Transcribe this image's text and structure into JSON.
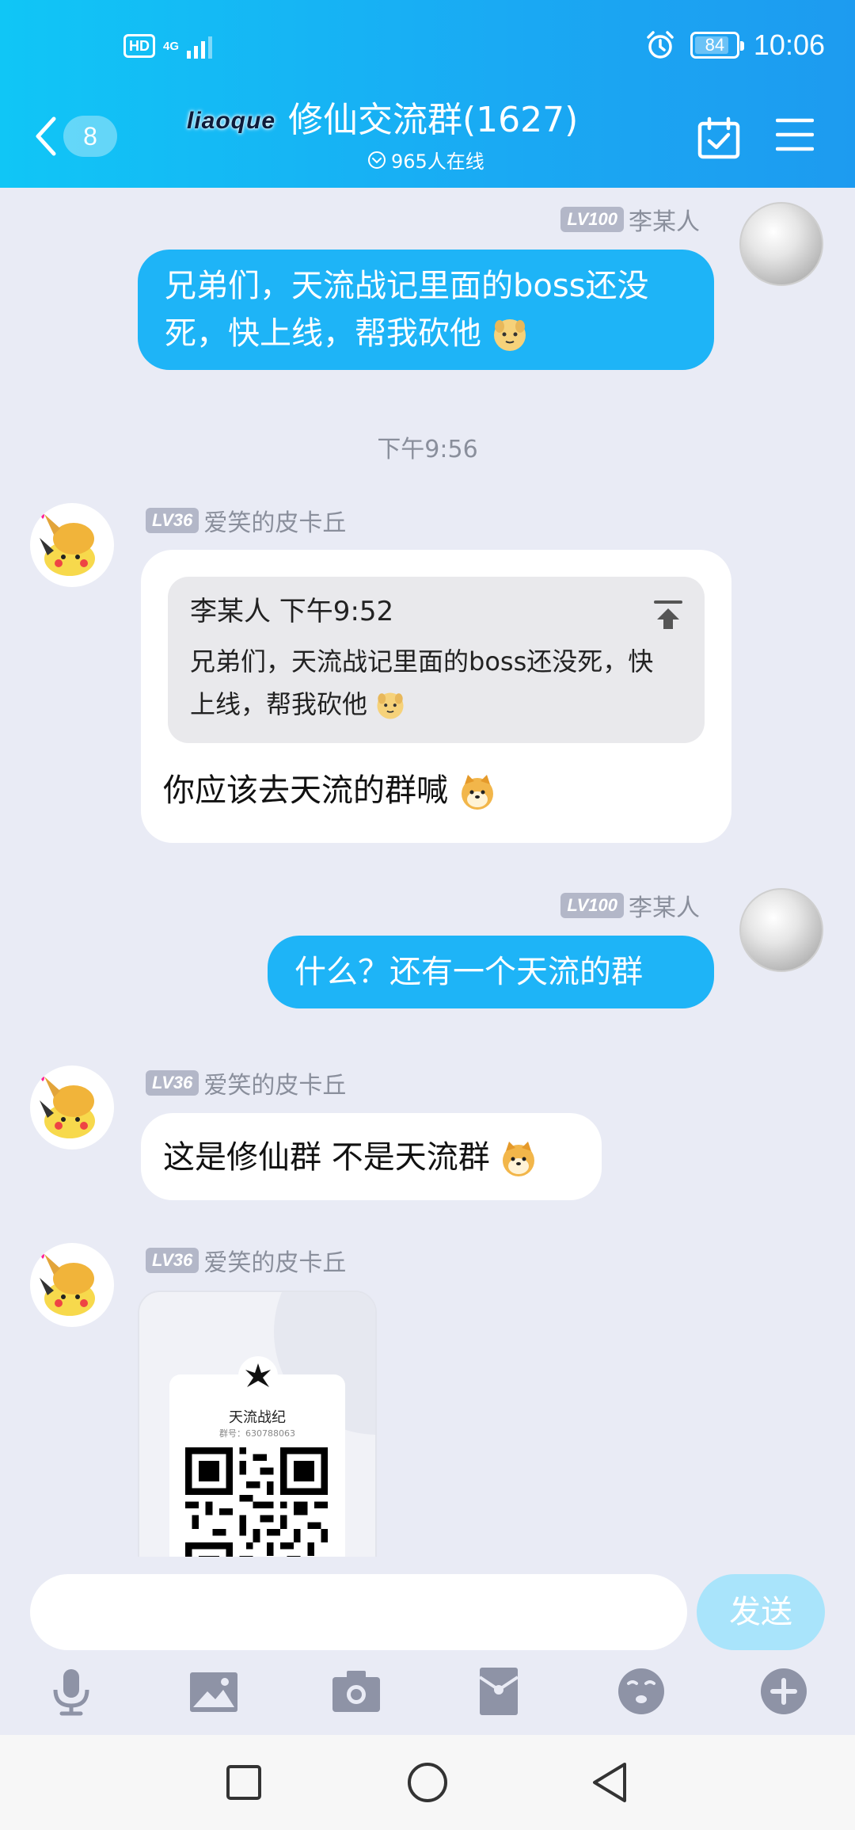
{
  "status_bar": {
    "hd": "HD",
    "network": "4G",
    "battery": "84",
    "battery_level": 0.84,
    "time": "10:06"
  },
  "header": {
    "unread_count": "8",
    "group_logo_text": "liaoque",
    "group_title": "修仙交流群(1627)",
    "online_text": "965人在线"
  },
  "messages": {
    "m1": {
      "lv": "LV100",
      "sender": "李某人",
      "text": "兄弟们，天流战记里面的boss还没死，快上线，帮我砍他"
    },
    "time_sep": "下午9:56",
    "m2": {
      "lv": "LV36",
      "sender": "爱笑的皮卡丘",
      "quote_header": "李某人 下午9:52",
      "quote_text": "兄弟们，天流战记里面的boss还没死，快上线，帮我砍他",
      "text": "你应该去天流的群喊"
    },
    "m3": {
      "lv": "LV100",
      "sender": "李某人",
      "text": "什么？还有一个天流的群"
    },
    "m4": {
      "lv": "LV36",
      "sender": "爱笑的皮卡丘",
      "text": "这是修仙群 不是天流群"
    },
    "m5": {
      "lv": "LV36",
      "sender": "爱笑的皮卡丘",
      "card_title": "天流战纪",
      "card_number": "群号：630788063"
    }
  },
  "input": {
    "value": "",
    "placeholder": "",
    "send_label": "发送"
  },
  "colors": {
    "header_start": "#10c6f6",
    "header_end": "#1d9bf0",
    "bubble_self": "#1eb4f7",
    "chat_bg": "#e9ebf5",
    "send_disabled": "#a9e4fb"
  },
  "icons": {
    "toolbar": [
      "microphone-icon",
      "image-icon",
      "camera-icon",
      "red-packet-icon",
      "emoji-icon",
      "plus-icon"
    ],
    "system_nav": [
      "recent-apps-icon",
      "home-icon",
      "back-triangle-icon"
    ]
  }
}
